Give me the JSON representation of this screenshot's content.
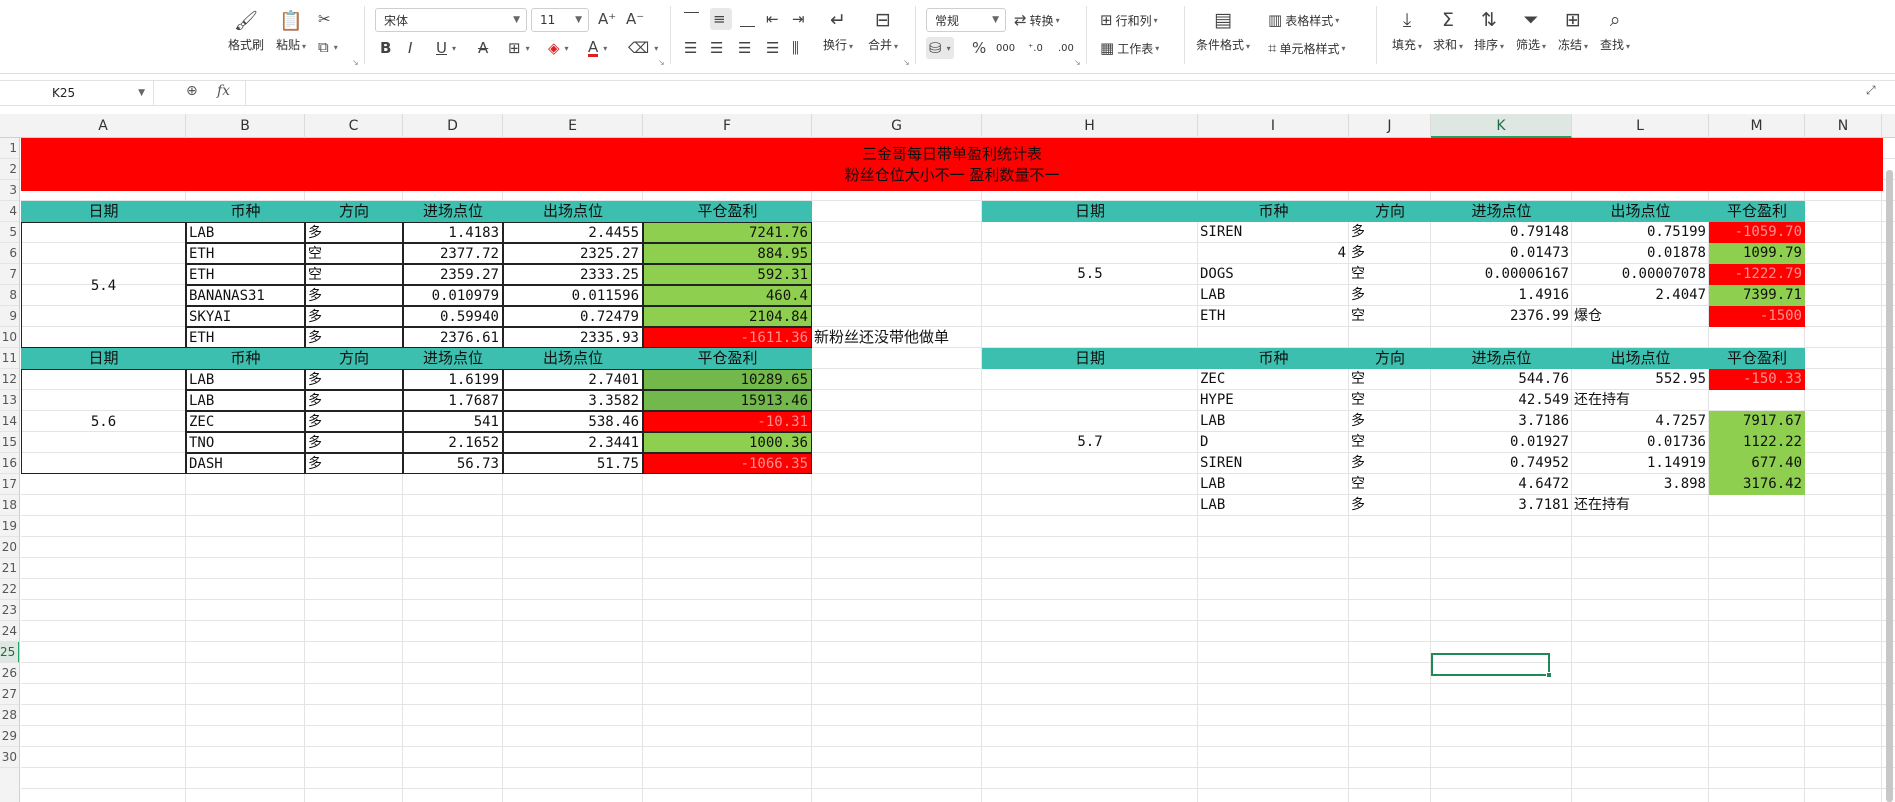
{
  "ribbon": {
    "format_painter": "格式刷",
    "paste": "粘贴",
    "font_name": "宋体",
    "font_size": "11",
    "wrap": "换行",
    "merge": "合并",
    "number_format": "常规",
    "convert": "转换",
    "rows_cols": "行和列",
    "worksheet": "工作表",
    "conditional_format": "条件格式",
    "table_style": "表格样式",
    "cell_style": "单元格样式",
    "fill": "填充",
    "sum": "求和",
    "sort": "排序",
    "filter": "筛选",
    "freeze": "冻结",
    "find": "查找",
    "percent_symbol": "%",
    "thousands_symbol": "000"
  },
  "formula_bar": {
    "name_box": "K25",
    "fx_label": "fx",
    "formula": ""
  },
  "columns": [
    "A",
    "B",
    "C",
    "D",
    "E",
    "F",
    "G",
    "H",
    "I",
    "J",
    "K",
    "L",
    "M",
    "N"
  ],
  "selected_column": "K",
  "rows": [
    "1",
    "2",
    "3",
    "4",
    "5",
    "6",
    "7",
    "8",
    "9",
    "10",
    "11",
    "12",
    "13",
    "14",
    "15",
    "16",
    "17",
    "18",
    "19",
    "20",
    "21",
    "22",
    "23",
    "24",
    "25",
    "26",
    "27",
    "28",
    "29",
    "30"
  ],
  "selected_row": "25",
  "sheet": {
    "title_line1": "三金哥每日带单盈利统计表",
    "title_line2": "粉丝仓位大小不一 盈利数量不一",
    "headers": [
      "日期",
      "币种",
      "方向",
      "进场点位",
      "出场点位",
      "平仓盈利"
    ],
    "left_block1": {
      "date": "5.4",
      "rows": [
        [
          "LAB",
          "多",
          "1.4183",
          "2.4455",
          "7241.76"
        ],
        [
          "ETH",
          "空",
          "2377.72",
          "2325.27",
          "884.95"
        ],
        [
          "ETH",
          "空",
          "2359.27",
          "2333.25",
          "592.31"
        ],
        [
          "BANANAS31",
          "多",
          "0.010979",
          "0.011596",
          "460.4"
        ],
        [
          "SKYAI",
          "多",
          "0.59940",
          "0.72479",
          "2104.84"
        ],
        [
          "ETH",
          "多",
          "2376.61",
          "2335.93",
          "-1611.36"
        ]
      ],
      "note": "新粉丝还没带他做单"
    },
    "left_block2": {
      "date": "5.6",
      "rows": [
        [
          "LAB",
          "多",
          "1.6199",
          "2.7401",
          "10289.65"
        ],
        [
          "LAB",
          "多",
          "1.7687",
          "3.3582",
          "15913.46"
        ],
        [
          "ZEC",
          "多",
          "541",
          "538.46",
          "-10.31"
        ],
        [
          "TNO",
          "多",
          "2.1652",
          "2.3441",
          "1000.36"
        ],
        [
          "DASH",
          "多",
          "56.73",
          "51.75",
          "-1066.35"
        ]
      ]
    },
    "right_block1": {
      "date": "5.5",
      "rows": [
        [
          "SIREN",
          "多",
          "0.79148",
          "0.75199",
          "-1059.70"
        ],
        [
          "4",
          "多",
          "0.01473",
          "0.01878",
          "1099.79"
        ],
        [
          "DOGS",
          "空",
          "0.00006167",
          "0.00007078",
          "-1222.79"
        ],
        [
          "LAB",
          "多",
          "1.4916",
          "2.4047",
          "7399.71"
        ],
        [
          "ETH",
          "空",
          "2376.99",
          "爆仓",
          "-1500"
        ]
      ]
    },
    "right_block2": {
      "date": "5.7",
      "rows": [
        [
          "ZEC",
          "空",
          "544.76",
          "552.95",
          "-150.33"
        ],
        [
          "HYPE",
          "空",
          "42.549",
          "还在持有",
          ""
        ],
        [
          "LAB",
          "多",
          "3.7186",
          "4.7257",
          "7917.67"
        ],
        [
          "D",
          "空",
          "0.01927",
          "0.01736",
          "1122.22"
        ],
        [
          "SIREN",
          "多",
          "0.74952",
          "1.14919",
          "677.40"
        ],
        [
          "LAB",
          "空",
          "4.6472",
          "3.898",
          "3176.42"
        ],
        [
          "LAB",
          "多",
          "3.7181",
          "还在持有",
          ""
        ]
      ]
    }
  },
  "colors": {
    "banner": "#ff0000",
    "header_teal": "#3cbfae",
    "profit_green": "#8fcf4f",
    "loss_red": "#ff0000",
    "selection": "#1e8a55"
  }
}
